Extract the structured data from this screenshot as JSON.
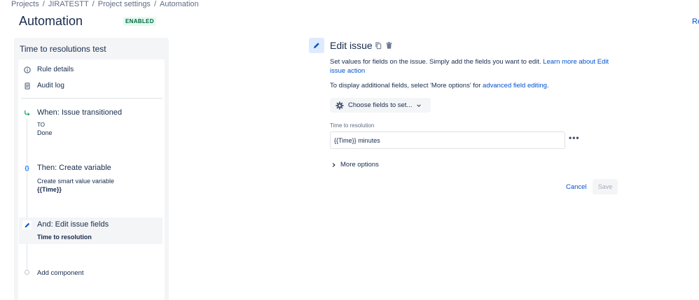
{
  "breadcrumb": [
    "Projects",
    "JIRATESTT",
    "Project settings",
    "Automation"
  ],
  "header": {
    "title": "Automation",
    "status_badge": "ENABLED",
    "top_right_link": "Re"
  },
  "rule": {
    "name": "Time to resolutions test",
    "menu": [
      {
        "label": "Rule details",
        "icon": "info-icon"
      },
      {
        "label": "Audit log",
        "icon": "document-icon"
      }
    ],
    "steps": [
      {
        "title": "When: Issue transitioned",
        "sub_label": "TO",
        "sub_value": "Done",
        "icon": "transition-icon"
      },
      {
        "title": "Then: Create variable",
        "sub_label": "Create smart value variable",
        "sub_value": "{{Time}}",
        "icon": "braces-icon",
        "icon_glyph": "{}"
      },
      {
        "title": "And: Edit issue fields",
        "sub_value": "Time to resolution",
        "icon": "pencil-icon",
        "selected": true
      }
    ],
    "add_component": "Add component"
  },
  "editor": {
    "title": "Edit issue",
    "desc_text": "Set values for fields on the issue. Simply add the fields you want to edit. ",
    "desc_link": "Learn more about Edit issue action",
    "advanced_prefix": "To display additional fields, select 'More options' for ",
    "advanced_link": "advanced field editing",
    "advanced_suffix": ".",
    "choose_fields": "Choose fields to set...",
    "field_label": "Time to resolution",
    "field_value": "{{Time}} minutes",
    "more_options": "More options",
    "cancel": "Cancel",
    "save": "Save"
  },
  "colors": {
    "link": "#0052cc",
    "badge_bg": "#e3fcef",
    "badge_text": "#006644",
    "transition_icon": "#36b37e",
    "braces_icon": "#0065ff",
    "pencil_icon": "#0052cc"
  }
}
